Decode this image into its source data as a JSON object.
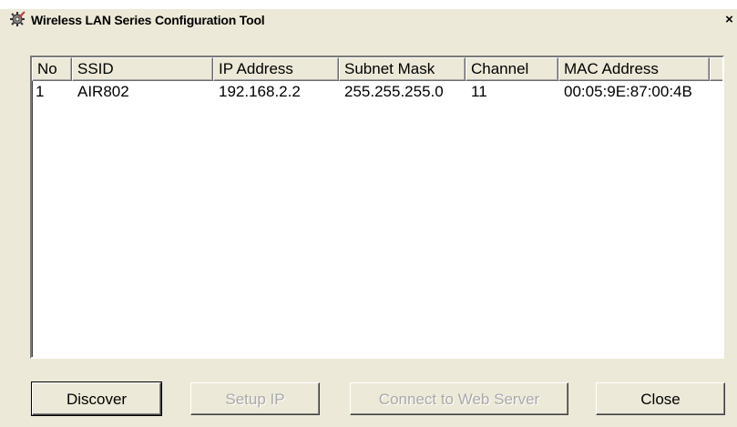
{
  "window": {
    "title": "Wireless LAN Series Configuration Tool",
    "close_glyph": "×",
    "icon": "gear-wrench-icon"
  },
  "table": {
    "columns": [
      "No",
      "SSID",
      "IP Address",
      "Subnet Mask",
      "Channel",
      "MAC Address"
    ],
    "rows": [
      {
        "no": "1",
        "ssid": "AIR802",
        "ip": "192.168.2.2",
        "subnet": "255.255.255.0",
        "channel": "11",
        "mac": "00:05:9E:87:00:4B"
      }
    ]
  },
  "buttons": {
    "discover": "Discover",
    "setup_ip": "Setup IP",
    "connect": "Connect to Web Server",
    "close": "Close"
  },
  "colors": {
    "face": "#ece9d8",
    "disabled_text": "#a9a9a9"
  }
}
